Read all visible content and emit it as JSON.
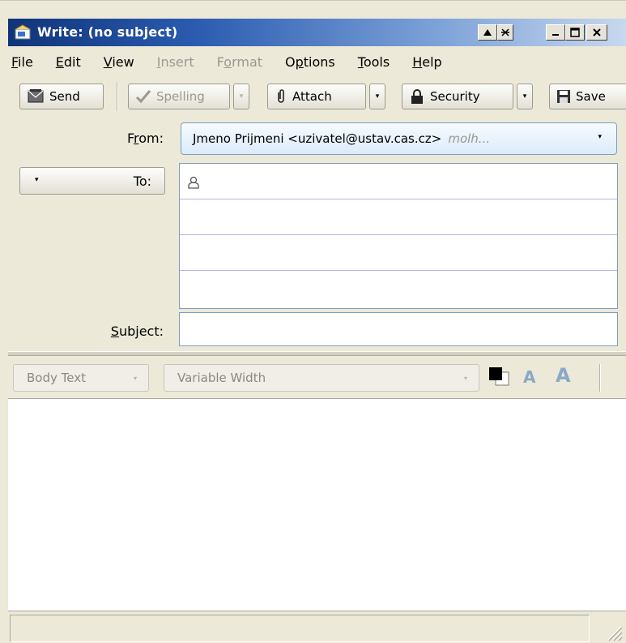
{
  "window": {
    "title": "Write: (no subject)",
    "controls": [
      "▲",
      "⨯",
      "_",
      "□",
      "×"
    ]
  },
  "menu": [
    {
      "label": "File",
      "mnemonic": "F",
      "rest": "ile",
      "enabled": true
    },
    {
      "label": "Edit",
      "mnemonic": "E",
      "rest": "dit",
      "enabled": true
    },
    {
      "label": "View",
      "mnemonic": "V",
      "rest": "iew",
      "enabled": true
    },
    {
      "label": "Insert",
      "mnemonic": "I",
      "rest": "nsert",
      "enabled": false
    },
    {
      "label": "Format",
      "mnemonic": "o",
      "rest": "rmat",
      "enabled": false
    },
    {
      "label": "Options",
      "mnemonic": "p",
      "rest": "tions",
      "enabled": true
    },
    {
      "label": "Tools",
      "mnemonic": "T",
      "rest": "ools",
      "enabled": true
    },
    {
      "label": "Help",
      "mnemonic": "H",
      "rest": "elp",
      "enabled": true
    }
  ],
  "toolbar": {
    "send": "Send",
    "spelling": "Spelling",
    "attach": "Attach",
    "security": "Security",
    "save": "Save",
    "dropdown_glyph": "▾"
  },
  "header": {
    "from_label_pre": "F",
    "from_label_mn": "r",
    "from_label_post": "om:",
    "from_value": "Jmeno Prijmeni <uzivatel@ustav.cas.cz>",
    "from_account": "molh...",
    "to_label": "To:",
    "subject_label_mn": "S",
    "subject_label_post": "ubject:",
    "subject_value": "",
    "recipient_rows": 4
  },
  "format_toolbar": {
    "paragraph_style": "Body Text",
    "font": "Variable Width",
    "text_color": "#000000",
    "background_color": "#ffffff",
    "smaller_glyph": "A",
    "larger_glyph": "A"
  },
  "status": {
    "text": ""
  },
  "colors": {
    "title_start": "#10347a",
    "title_end": "#c7d8ef",
    "chrome": "#ece9d8",
    "field_border": "#7f9db9",
    "row_divider": "#b9b5e8"
  }
}
